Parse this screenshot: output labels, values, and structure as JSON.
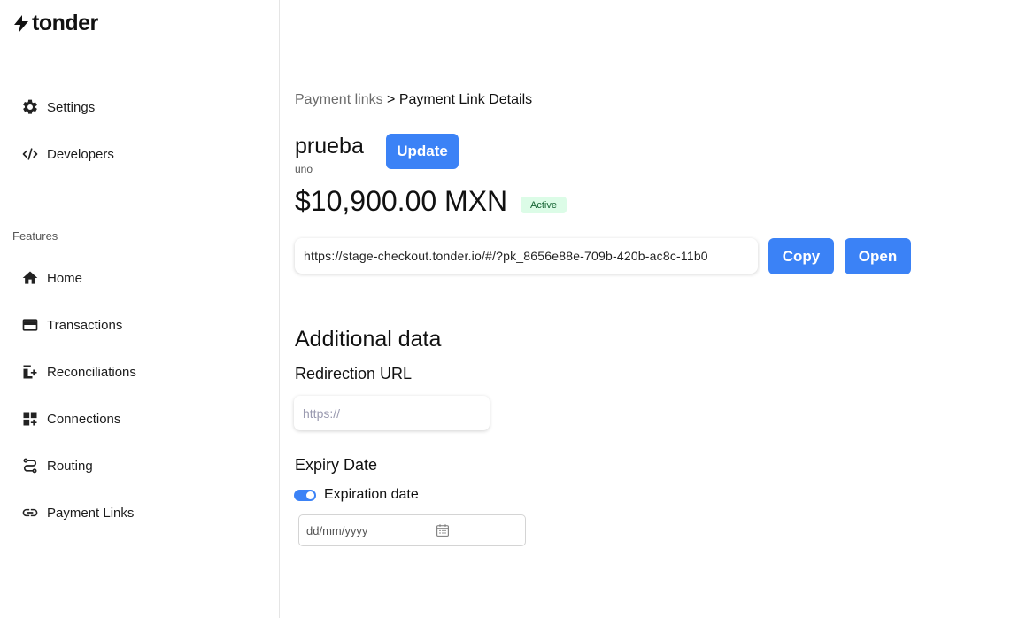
{
  "brand": {
    "name": "tonder"
  },
  "sidebar": {
    "top_items": [
      {
        "label": "Settings",
        "icon": "gear-icon"
      },
      {
        "label": "Developers",
        "icon": "code-icon"
      }
    ],
    "section_label": "Features",
    "feature_items": [
      {
        "label": "Home",
        "icon": "home-icon"
      },
      {
        "label": "Transactions",
        "icon": "card-icon"
      },
      {
        "label": "Reconciliations",
        "icon": "reconciliation-icon"
      },
      {
        "label": "Connections",
        "icon": "widgets-icon"
      },
      {
        "label": "Routing",
        "icon": "route-icon"
      },
      {
        "label": "Payment Links",
        "icon": "link-icon"
      }
    ]
  },
  "breadcrumb": {
    "parent": "Payment links",
    "separator": ">",
    "current": "Payment Link Details"
  },
  "link": {
    "name": "prueba",
    "description": "uno",
    "update_label": "Update",
    "amount": "$10,900.00 MXN",
    "status": "Active",
    "url": "https://stage-checkout.tonder.io/#/?pk_8656e88e-709b-420b-ac8c-11b0",
    "copy_label": "Copy",
    "open_label": "Open"
  },
  "additional": {
    "heading": "Additional data",
    "redirect_heading": "Redirection URL",
    "redirect_placeholder": "https://",
    "expiry_heading": "Expiry Date",
    "expiry_toggle_label": "Expiration date",
    "expiry_toggle_on": true,
    "date_placeholder": "dd/mm/yyyy"
  },
  "colors": {
    "accent": "#3b82f6",
    "badge_bg": "#dcfce7",
    "badge_text": "#166534"
  }
}
